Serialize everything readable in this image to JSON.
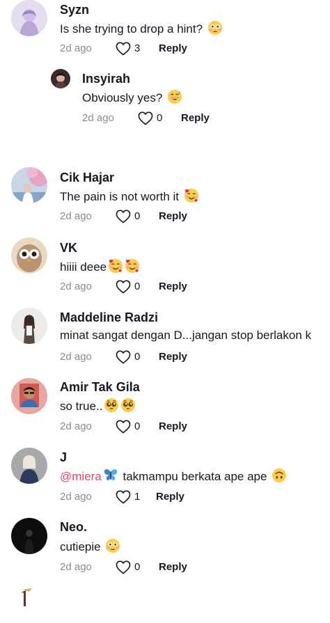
{
  "comments": [
    {
      "username": "Syzn",
      "text": "Is she trying to drop a hint?",
      "time": "2d ago",
      "likes": "3",
      "reply": "Reply",
      "avatar_icon": "avatar-syzn"
    },
    {
      "username": "Insyirah",
      "text": "Obviously yes?",
      "time": "2d ago",
      "likes": "0",
      "reply": "Reply",
      "avatar_icon": "avatar-insyirah"
    },
    {
      "username": "Cik Hajar",
      "text": "The pain is not worth it",
      "time": "2d ago",
      "likes": "0",
      "reply": "Reply",
      "avatar_icon": "avatar-cik-hajar"
    },
    {
      "username": "VK",
      "text": "hiiii deee",
      "time": "2d ago",
      "likes": "0",
      "reply": "Reply",
      "avatar_icon": "avatar-vk"
    },
    {
      "username": "Maddeline Radzi",
      "text": "minat sangat dengan D...jangan stop berlakon k",
      "time": "2d ago",
      "likes": "0",
      "reply": "Reply",
      "avatar_icon": "avatar-maddeline"
    },
    {
      "username": "Amir Tak Gila",
      "text": "so true..",
      "time": "2d ago",
      "likes": "0",
      "reply": "Reply",
      "avatar_icon": "avatar-amir"
    },
    {
      "username": "J",
      "mention": "@miera",
      "text": "takmampu berkata ape ape",
      "time": "2d ago",
      "likes": "1",
      "reply": "Reply",
      "avatar_icon": "avatar-j"
    },
    {
      "username": "Neo.",
      "text": "cutiepie",
      "time": "2d ago",
      "likes": "0",
      "reply": "Reply",
      "avatar_icon": "avatar-neo"
    }
  ],
  "icons": {
    "like": "heart-outline-icon",
    "flushed": "flushed-face-emoji",
    "sweat_smile": "grinning-sweat-emoji",
    "hearts_face": "smiling-face-with-hearts-emoji",
    "pleading": "pleading-face-emoji",
    "butterfly": "butterfly-emoji",
    "upside_down": "upside-down-face-emoji"
  },
  "colors": {
    "text": "#161823",
    "muted": "#8a8b91",
    "mention": "#e8436b"
  }
}
